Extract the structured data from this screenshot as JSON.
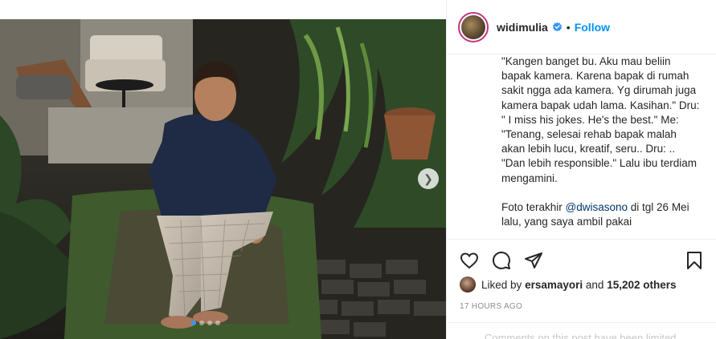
{
  "post": {
    "username": "widimulia",
    "separator": "•",
    "follow_label": "Follow",
    "caption_before_mention": "\"Kangen banget bu. Aku mau beliin bapak kamera. Karena bapak di rumah sakit ngga ada kamera. Yg dirumah juga kamera bapak udah lama. Kasihan.\" Dru: \" I miss his jokes. He's the best.\" Me:\n\"Tenang, selesai rehab bapak malah akan lebih lucu, kreatif, seru.. Dru: ..\n\"Dan lebih responsible.\" Lalu ibu terdiam mengamini.\n\nFoto terakhir ",
    "caption_mention": "@dwisasono",
    "caption_after_mention": " di tgl 26 Mei lalu, yang saya ambil pakai",
    "liked_prefix": "Liked by",
    "liked_user": "ersamayori",
    "liked_and": "and",
    "liked_count": "15,202 others",
    "timestamp": "17 HOURS AGO",
    "comments_notice": "Comments on this post have been limited."
  },
  "carousel": {
    "next_icon": "chevron-right-icon",
    "slide_count": 4,
    "active_slide": 1
  },
  "colors": {
    "accent": "#0095f6",
    "verified": "#3897f0",
    "text": "#262626",
    "muted": "#8e8e8e"
  },
  "icons": [
    "heart-icon",
    "comment-icon",
    "share-icon",
    "bookmark-icon",
    "verified-badge-icon"
  ]
}
